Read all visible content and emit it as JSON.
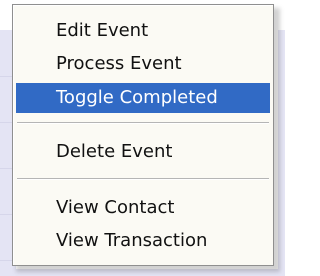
{
  "context_menu": {
    "items": [
      {
        "label": "Edit Event"
      },
      {
        "label": "Process Event"
      },
      {
        "label": "Toggle Completed",
        "highlighted": true
      },
      {
        "label": "Delete Event"
      },
      {
        "label": "View Contact"
      },
      {
        "label": "View Transaction"
      }
    ]
  },
  "colors": {
    "highlight": "#316ac5",
    "menu_background": "#fbfaf4",
    "background": "#e4e4f4"
  }
}
